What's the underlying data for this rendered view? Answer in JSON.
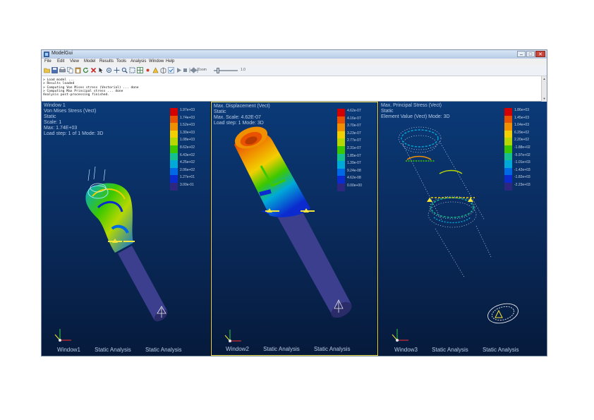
{
  "window": {
    "title": "ModelGui",
    "controls": [
      "–",
      "□",
      "✕"
    ]
  },
  "menu": [
    "File",
    "Edit",
    "View",
    "Model",
    "Results",
    "Tools",
    "Analysis",
    "Window",
    "Help"
  ],
  "toolbar": {
    "icons": [
      "folder-open-icon",
      "save-icon",
      "print-icon",
      "copy-icon",
      "paste-icon",
      "refresh-icon",
      "delete-icon",
      "select-icon",
      "rotate-icon",
      "pan-icon",
      "zoom-icon",
      "fit-icon",
      "mesh-icon",
      "node-icon",
      "element-icon",
      "wireframe-icon",
      "check-icon",
      "play-icon",
      "stop-icon",
      "step-back-icon",
      "step-forward-icon"
    ],
    "zoom_label": "Zoom",
    "speed_value": "1.0"
  },
  "console": {
    "lines": [
      "> Load model ...",
      "> Results loaded",
      "> Computing Von Mises stress (Vectorial) ... done",
      "> Computing Max Principal stress ... done",
      "Analysis post-processing finished."
    ],
    "scroll": [
      "▲",
      "▼"
    ]
  },
  "viewports": [
    {
      "header": [
        "Window 1",
        "Von Mises Stress (Vect)",
        "Static",
        "Scale: 1",
        "Max: 1.74E+03",
        "Load step: 1 of 1   Mode: 3D"
      ],
      "legend": [
        "1.97e+03",
        "1.74e+03",
        "1.52e+03",
        "1.30e+03",
        "1.08e+03",
        "8.62e+02",
        "6.43e+02",
        "4.25e+02",
        "2.06e+02",
        "1.27e+01",
        "3.00e-01"
      ],
      "footer": [
        "Window1",
        "Static Analysis",
        "Static Analysis"
      ]
    },
    {
      "header": [
        "Max. Displacement (Vect)",
        "Static",
        "Max. Scale: 4.62E-07",
        "Load step: 1   Mode: 3D"
      ],
      "legend": [
        "4.62e-07",
        "4.16e-07",
        "3.70e-07",
        "3.23e-07",
        "2.77e-07",
        "2.31e-07",
        "1.85e-07",
        "1.39e-07",
        "9.24e-08",
        "4.62e-08",
        "0.00e+00"
      ],
      "footer": [
        "Window2",
        "Static Analysis",
        "Static Analysis"
      ]
    },
    {
      "header": [
        "Max. Principal Stress (Vect)",
        "Static",
        "Element Value (Vect)   Mode: 3D"
      ],
      "legend": [
        "1.86e+03",
        "1.45e+03",
        "1.04e+03",
        "6.29e+02",
        "2.20e+02",
        "-1.88e+02",
        "-5.97e+02",
        "-1.01e+03",
        "-1.42e+03",
        "-1.82e+03",
        "-2.23e+03"
      ],
      "footer": [
        "Window3",
        "Static Analysis",
        "Static Analysis"
      ]
    }
  ],
  "colors": {
    "legend_scale": [
      "#d40000",
      "#e85200",
      "#f09000",
      "#f2cf00",
      "#b6d800",
      "#3cc800",
      "#14c090",
      "#00a9d8",
      "#006ae6",
      "#0b2bcf",
      "#2d2780"
    ],
    "model_body": "#3c3f8e",
    "active_border": "#e8d94a",
    "marker": "#f3e63a"
  }
}
